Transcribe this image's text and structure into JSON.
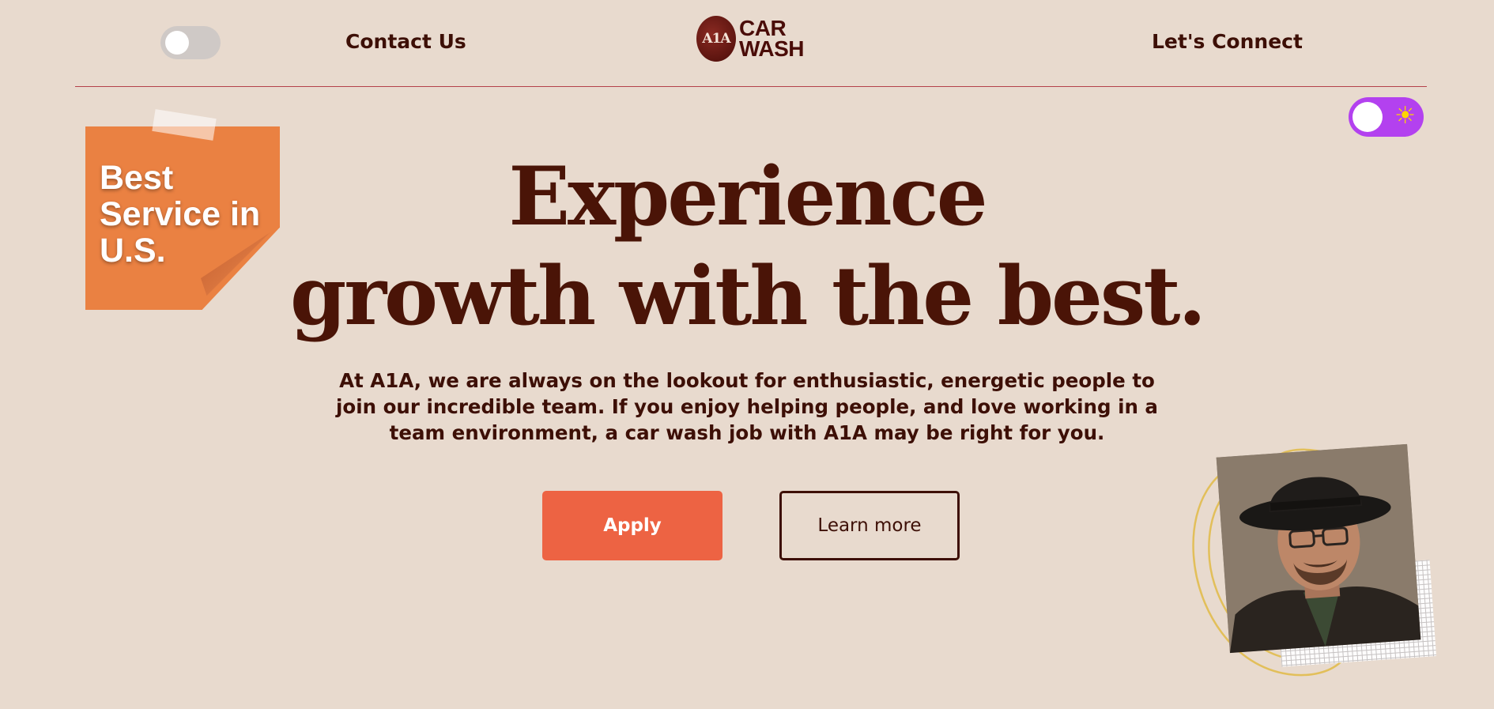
{
  "header": {
    "contact_link": "Contact Us",
    "connect_link": "Let's Connect",
    "logo": {
      "emblem": "A1A",
      "line1": "CAR",
      "line2": "WASH"
    }
  },
  "theme_toggle": {
    "state": "light",
    "icon": "sun-icon"
  },
  "sticky_note": {
    "line1": "Best",
    "line2": "Service in",
    "line3": "U.S."
  },
  "hero": {
    "title_line1": "Experience",
    "title_line2": "growth with the best.",
    "description": "At A1A, we are always on the lookout for enthusiastic, energetic people to join our incredible team. If you enjoy helping people, and love working in a team environment, a car wash job with A1A may be right for you.",
    "apply_label": "Apply",
    "learn_more_label": "Learn more"
  },
  "colors": {
    "background": "#e8dace",
    "primary_text": "#3d0f06",
    "accent": "#ed6343",
    "sticky_note": "#ea8142",
    "toggle_active": "#b341ef",
    "divider": "#b4414b"
  }
}
